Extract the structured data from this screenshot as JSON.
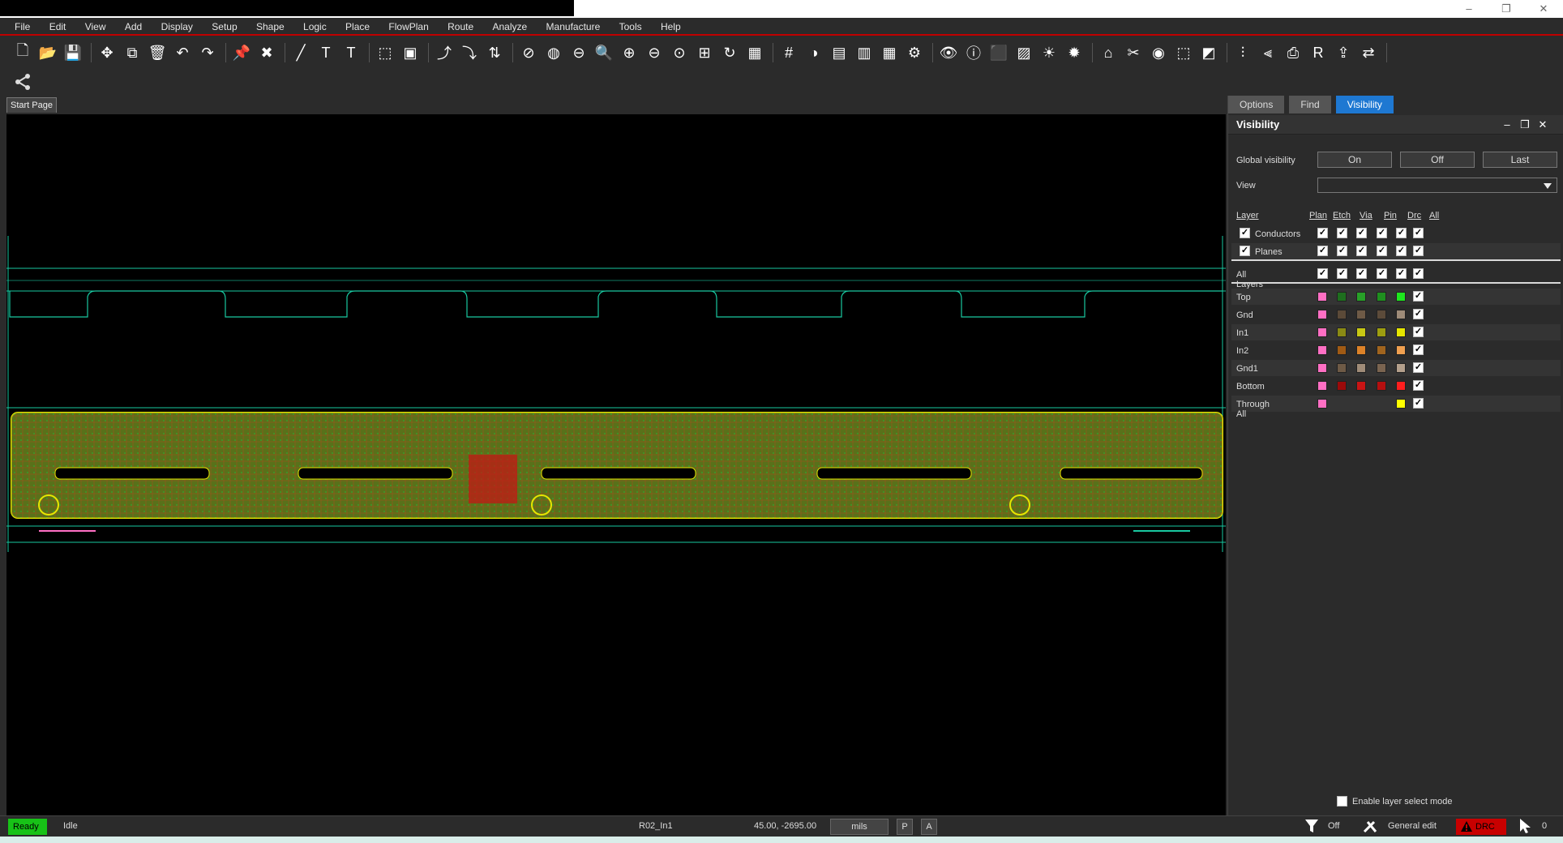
{
  "menu": [
    "File",
    "Edit",
    "View",
    "Add",
    "Display",
    "Setup",
    "Shape",
    "Logic",
    "Place",
    "FlowPlan",
    "Route",
    "Analyze",
    "Manufacture",
    "Tools",
    "Help"
  ],
  "window_controls": {
    "minimize": "–",
    "restore": "❐",
    "close": "✕"
  },
  "toolbar_icons": [
    "new-file-icon",
    "open-folder-icon",
    "save-icon",
    "move-icon",
    "copy-icon",
    "delete-icon",
    "undo-icon",
    "redo-icon",
    "pin-icon",
    "unpin-icon",
    "add-line-icon",
    "add-text-icon",
    "edit-text-icon",
    "place-component-icon",
    "chip-icon",
    "route-icon",
    "interactive-route-icon",
    "swap-icon",
    "stop-icon",
    "refresh-design-icon",
    "zoom-out-minus-icon",
    "zoom-search-icon",
    "zoom-in-icon",
    "zoom-out-icon",
    "zoom-prev-icon",
    "zoom-fit-icon",
    "refresh-icon",
    "board-icon",
    "grid-icon",
    "color-icon",
    "layers-icon",
    "stack-icon",
    "report-icon",
    "settings-icon",
    "eye-icon",
    "info-icon",
    "3d-view-icon",
    "hatch-icon",
    "brightness-icon",
    "highlight-icon",
    "home-icon",
    "cut-icon",
    "globe-icon",
    "select-icon",
    "contrast-icon",
    "filter-icon",
    "compare-icon",
    "print-icon",
    "r2-icon",
    "export-icon",
    "sync-icon",
    "share-icon"
  ],
  "document_tab": "Start Page",
  "panel": {
    "tabs": [
      "Options",
      "Find",
      "Visibility"
    ],
    "title": "Visibility",
    "global_visibility_label": "Global visibility",
    "buttons": {
      "on": "On",
      "off": "Off",
      "last": "Last"
    },
    "view_label": "View",
    "view_value": "",
    "headers": {
      "layer": "Layer",
      "plan": "Plan",
      "etch": "Etch",
      "via": "Via",
      "pin": "Pin",
      "drc": "Drc",
      "all": "All"
    },
    "groups": [
      {
        "name": "Conductors"
      },
      {
        "name": "Planes"
      }
    ],
    "all_layers_label": "All Layers",
    "layers": [
      {
        "name": "Top",
        "plan": "#ff6fc4",
        "etch": "#1e6e1e",
        "via": "#28a028",
        "pin": "#1f8f1f",
        "drc": "#1ee61e"
      },
      {
        "name": "Gnd",
        "plan": "#ff6fc4",
        "etch": "#5b4a38",
        "via": "#6e5a46",
        "pin": "#5c4b3a",
        "drc": "#9e8b78"
      },
      {
        "name": "In1",
        "plan": "#ff6fc4",
        "etch": "#8a8a14",
        "via": "#c8c814",
        "pin": "#9e9e10",
        "drc": "#e6e600"
      },
      {
        "name": "In2",
        "plan": "#ff6fc4",
        "etch": "#a05a14",
        "via": "#dc8228",
        "pin": "#a0641e",
        "drc": "#f0a050"
      },
      {
        "name": "Gnd1",
        "plan": "#ff6fc4",
        "etch": "#6e5a46",
        "via": "#a08c78",
        "pin": "#7a6450",
        "drc": "#b4a08c"
      },
      {
        "name": "Bottom",
        "plan": "#ff6fc4",
        "etch": "#9b0a0a",
        "via": "#c81414",
        "pin": "#b40f0f",
        "drc": "#ff1e1e"
      },
      {
        "name": "Through All",
        "plan": "#ff6fc4",
        "drc": "#ffff00"
      }
    ],
    "enable_layer_select": "Enable layer select mode"
  },
  "status": {
    "ready": "Ready",
    "mode": "Idle",
    "net": "R02_In1",
    "coords": "45.00, -2695.00",
    "units": "mils",
    "p": "P",
    "a": "A",
    "filter": "Off",
    "edit": "General edit",
    "drc": "DRC",
    "count": "0"
  }
}
